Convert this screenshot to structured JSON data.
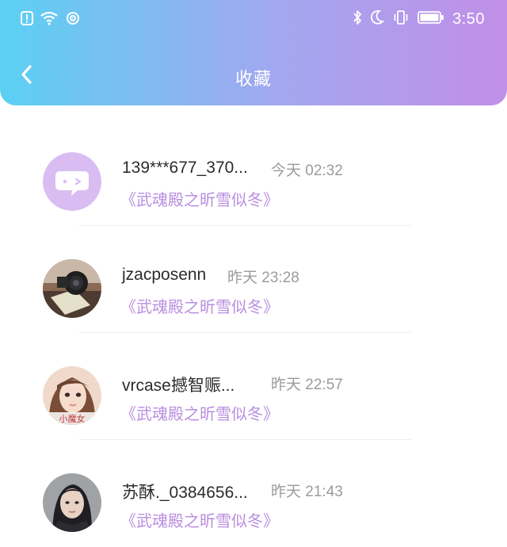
{
  "status_bar": {
    "time": "3:50",
    "left_icons": [
      "alert-icon",
      "wifi-icon",
      "hotspot-icon"
    ],
    "right_icons": [
      "bluetooth-icon",
      "moon-icon",
      "vibrate-icon",
      "battery-icon"
    ]
  },
  "header": {
    "title": "收藏",
    "back_icon": "chevron-left-icon",
    "gradient_colors": [
      "#5bd0f3",
      "#a3a7ef",
      "#c18fe8"
    ]
  },
  "favorites": [
    {
      "name": "139***677_370...",
      "time": "今天 02:32",
      "book": "《武魂殿之昕雪似冬》",
      "avatar": "default-chat-avatar"
    },
    {
      "name": "jzacposenn",
      "time": "昨天 23:28",
      "book": "《武魂殿之昕雪似冬》",
      "avatar": "camera-photo-avatar"
    },
    {
      "name": "vrcase撼智赈...",
      "time": "昨天 22:57",
      "book": "《武魂殿之昕雪似冬》",
      "avatar": "girl-photo-avatar",
      "avatar_caption": "小魔女"
    },
    {
      "name": "苏酥._0384656...",
      "time": "昨天 21:43",
      "book": "《武魂殿之昕雪似冬》",
      "avatar": "portrait-photo-avatar"
    }
  ],
  "colors": {
    "accent": "#b98ee0",
    "name_text": "#2c2c2c",
    "time_text": "#9b9b9b"
  }
}
